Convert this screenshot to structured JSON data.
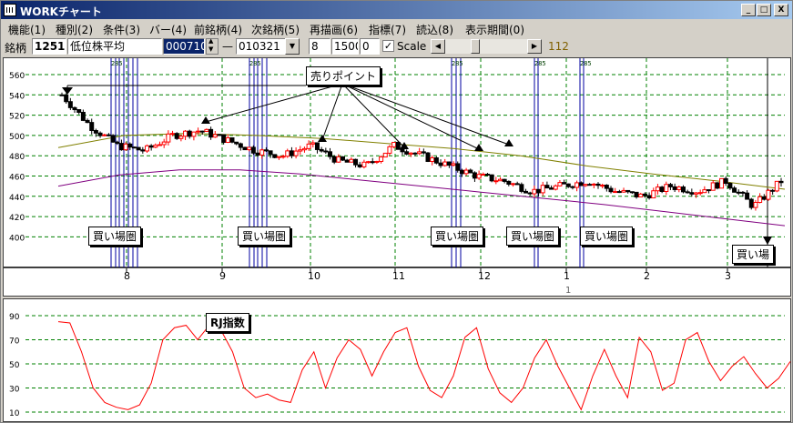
{
  "window": {
    "title": "WORKチャート"
  },
  "titlebar_buttons": {
    "minimize": "_",
    "maximize": "□",
    "close": "X"
  },
  "menu": [
    "機能(1)",
    "種別(2)",
    "条件(3)",
    "バー(4)",
    "前銘柄(4)",
    "次銘柄(5)",
    "再描画(6)",
    "指標(7)",
    "読込(8)",
    "表示期間(0)"
  ],
  "toolbar": {
    "code_label": "銘柄",
    "code_value": "1251",
    "name_value": "低位株平均",
    "period_value": "000710",
    "dash": "—",
    "date_value": "010321",
    "param1": "8",
    "param2": "1500",
    "param3": "0",
    "scale_checked": "✓",
    "scale_label": "Scale",
    "position_value": "112"
  },
  "price_axis": {
    "ticks": [
      "560",
      "540",
      "520",
      "500",
      "480",
      "460",
      "440",
      "420",
      "400"
    ]
  },
  "date_axis": {
    "months": [
      "8",
      "9",
      "10",
      "11",
      "12",
      "1",
      "2",
      "3"
    ],
    "year_marker": "1"
  },
  "rj_axis": {
    "ticks": [
      "90",
      "70",
      "50",
      "30",
      "10"
    ]
  },
  "annotations": {
    "sell_point": "売りポイント",
    "buy_zone": "買い場圏",
    "buy_zone_short": "買い場",
    "rj_label": "RJ指数",
    "vline_tag": "285"
  },
  "colors": {
    "up_candle": "#ff0000",
    "down_candle": "#000000",
    "ma_short": "#808000",
    "ma_long": "#800080",
    "rj_line": "#ff0000",
    "grid": "#008000",
    "signal_line": "#0000a0"
  },
  "chart_data": [
    {
      "type": "line",
      "title": "",
      "ylim": [
        395,
        570
      ],
      "x": [
        "8",
        "9",
        "10",
        "11",
        "12",
        "1",
        "2",
        "3"
      ],
      "series": [
        {
          "values": [
            540,
            510,
            490,
            485,
            500,
            505,
            495,
            485,
            480,
            490,
            475,
            470,
            490,
            480,
            470,
            460,
            455,
            445,
            450,
            455,
            445,
            440,
            450,
            445,
            455,
            430,
            455
          ]
        },
        {
          "values": [
            488,
            500,
            502,
            500,
            497,
            492,
            487,
            480,
            470,
            462,
            455,
            447
          ]
        },
        {
          "values": [
            450,
            461,
            466,
            466,
            462,
            456,
            450,
            444,
            438,
            432,
            425,
            418,
            411
          ]
        }
      ]
    },
    {
      "type": "line",
      "title": "RJ指数",
      "ylim": [
        10,
        90
      ],
      "series": [
        {
          "name": "RJ指数",
          "values": [
            85,
            84,
            60,
            30,
            18,
            14,
            12,
            16,
            34,
            70,
            80,
            82,
            70,
            82,
            78,
            60,
            30,
            22,
            25,
            20,
            18,
            45,
            60,
            30,
            55,
            70,
            62,
            40,
            60,
            76,
            80,
            48,
            28,
            22,
            40,
            72,
            80,
            46,
            26,
            18,
            30,
            55,
            70,
            48,
            30,
            12,
            40,
            62,
            40,
            22,
            72,
            60,
            28,
            34,
            70,
            76,
            52,
            36,
            48,
            56,
            42,
            30,
            38,
            52
          ]
        }
      ]
    }
  ]
}
